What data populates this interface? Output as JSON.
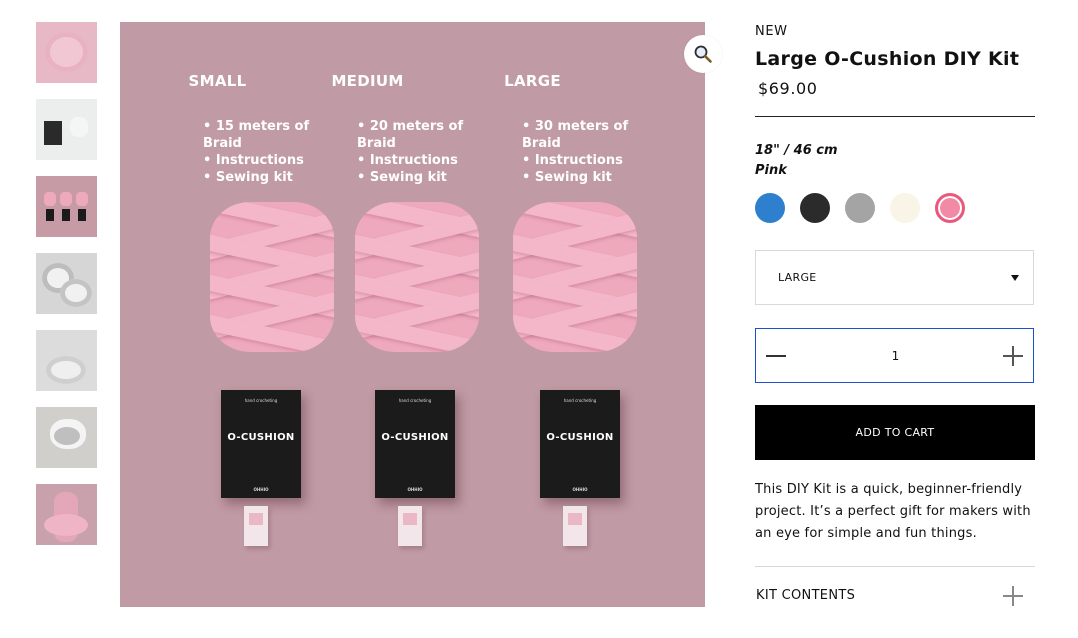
{
  "gallery": {
    "thumbnails": [
      {
        "name": "thumb-cushion-pink",
        "color": "#e7b8c6"
      },
      {
        "name": "thumb-kit-white",
        "color": "#eceded"
      },
      {
        "name": "thumb-sizes-pink",
        "color": "#c79ba6"
      },
      {
        "name": "thumb-cushions-grey",
        "color": "#d6d6d6"
      },
      {
        "name": "thumb-lifestyle-grey",
        "color": "#dcdcdc"
      },
      {
        "name": "thumb-chair-grey",
        "color": "#d0cfcc"
      },
      {
        "name": "thumb-model-pink",
        "color": "#c8a1ac"
      }
    ],
    "main_image": {
      "background": "#c09aa4",
      "columns": [
        {
          "title": "SMALL",
          "items": [
            "15 meters of Braid",
            "Instructions",
            "Sewing kit"
          ],
          "box_top": "hand crocheting",
          "box_title": "O-CUSHION",
          "box_brand": "OHHIO"
        },
        {
          "title": "MEDIUM",
          "items": [
            "20 meters of Braid",
            "Instructions",
            "Sewing kit"
          ],
          "box_top": "hand crocheting",
          "box_title": "O-CUSHION",
          "box_brand": "OHHIO"
        },
        {
          "title": "LARGE",
          "items": [
            "30 meters of Braid",
            "Instructions",
            "Sewing kit"
          ],
          "box_top": "hand crocheting",
          "box_title": "O-CUSHION",
          "box_brand": "OHHIO"
        }
      ]
    },
    "zoom_icon": "magnifier-icon"
  },
  "product": {
    "badge": "NEW",
    "title": "Large O-Cushion DIY Kit",
    "price": "$69.00",
    "size_label": "18\" / 46 cm",
    "selected_color": "Pink",
    "swatches": [
      {
        "name": "blue",
        "color": "#2f7fcf"
      },
      {
        "name": "black",
        "color": "#2b2b2b"
      },
      {
        "name": "grey",
        "color": "#a4a4a4"
      },
      {
        "name": "cream",
        "color": "#f8f5e6"
      },
      {
        "name": "pink",
        "color": "#f28aa6"
      }
    ],
    "size_select": {
      "value": "LARGE",
      "options": [
        "LARGE"
      ]
    },
    "quantity": "1",
    "add_to_cart": "ADD TO CART",
    "description": "This DIY Kit is a quick, beginner-friendly project. It’s a perfect gift for makers with an eye for simple and fun things.",
    "accordion": {
      "label": "KIT CONTENTS"
    }
  }
}
